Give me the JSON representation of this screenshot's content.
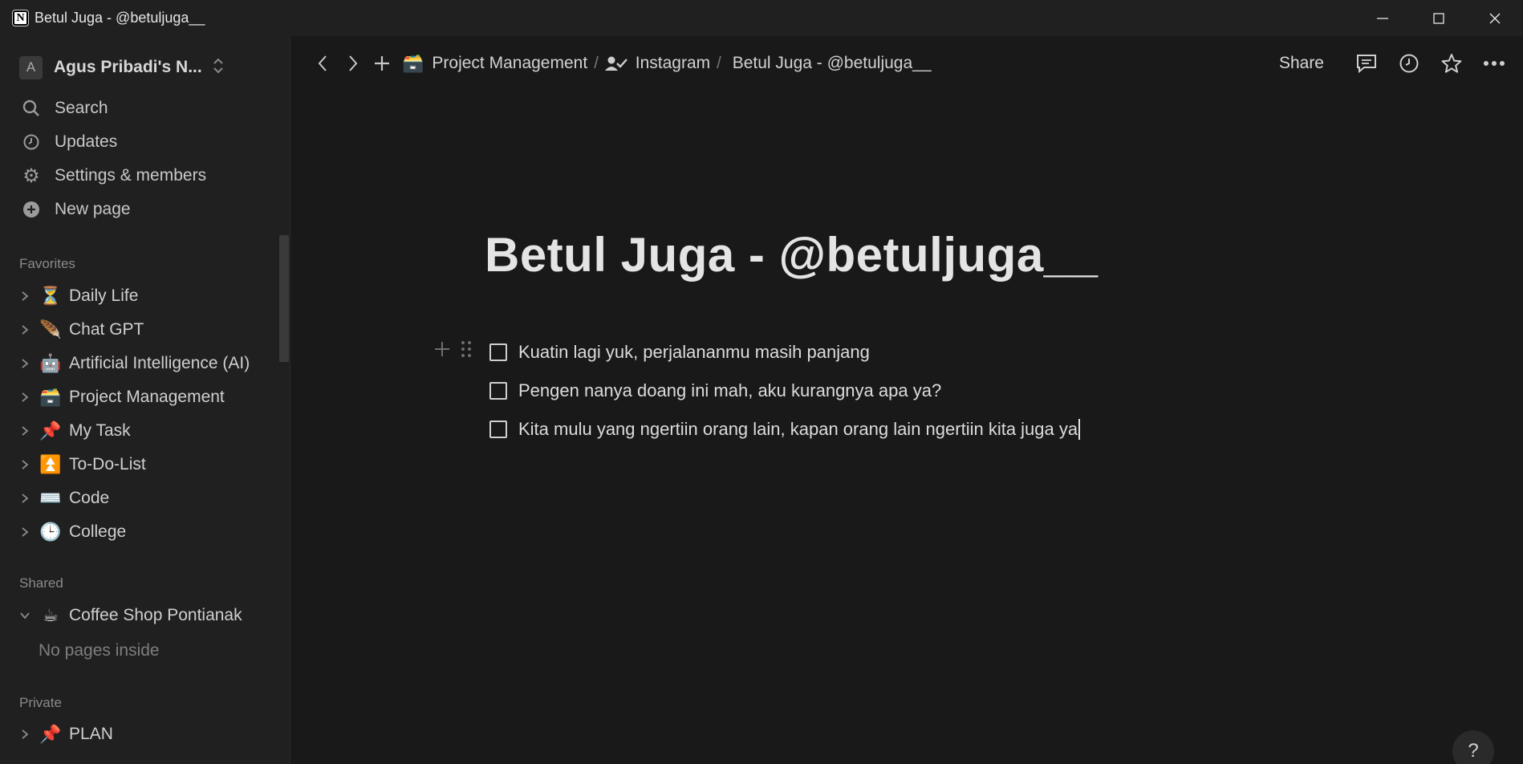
{
  "window": {
    "title": "Betul Juga - @betuljuga__",
    "app_icon": "N"
  },
  "sidebar": {
    "workspace": {
      "avatar": "A",
      "name": "Agus Pribadi's N..."
    },
    "nav": [
      {
        "icon": "search-icon",
        "label": "Search"
      },
      {
        "icon": "clock-icon",
        "label": "Updates"
      },
      {
        "icon": "gear-icon",
        "label": "Settings & members"
      },
      {
        "icon": "plus-circle-icon",
        "label": "New page"
      }
    ],
    "favorites_label": "Favorites",
    "favorites": [
      {
        "emoji": "⏳",
        "label": "Daily Life"
      },
      {
        "emoji": "🪶",
        "label": "Chat GPT"
      },
      {
        "emoji": "🤖",
        "label": "Artificial Intelligence (AI)"
      },
      {
        "emoji": "🗃️",
        "label": "Project Management"
      },
      {
        "emoji": "📌",
        "label": "My Task"
      },
      {
        "emoji": "⏫",
        "label": "To-Do-List"
      },
      {
        "emoji": "⌨️",
        "label": "Code"
      },
      {
        "emoji": "🕒",
        "label": "College"
      }
    ],
    "shared_label": "Shared",
    "shared": [
      {
        "emoji": "☕",
        "label": "Coffee Shop Pontianak",
        "empty_note": "No pages inside"
      }
    ],
    "private_label": "Private",
    "private": [
      {
        "emoji": "📌",
        "label": "PLAN"
      }
    ]
  },
  "topbar": {
    "breadcrumbs": [
      {
        "emoji": "🗃️",
        "label": "Project Management"
      },
      {
        "icon": "user-check-icon",
        "label": "Instagram"
      },
      {
        "label": "Betul Juga - @betuljuga__"
      }
    ],
    "share_label": "Share"
  },
  "page": {
    "title": "Betul Juga - @betuljuga__",
    "todos": [
      {
        "text": "Kuatin lagi yuk, perjalananmu masih panjang",
        "checked": false
      },
      {
        "text": "Pengen nanya doang ini mah, aku kurangnya apa ya?",
        "checked": false
      },
      {
        "text": "Kita mulu yang ngertiin orang lain, kapan orang lain ngertiin kita juga ya",
        "checked": false
      }
    ]
  },
  "help_label": "?"
}
